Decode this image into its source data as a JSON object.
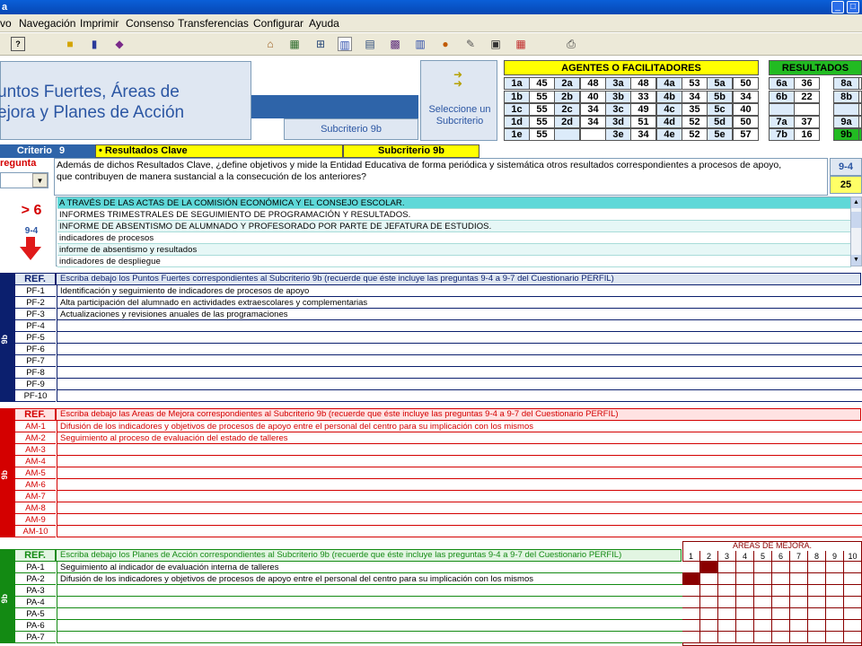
{
  "window": {
    "title_fragment": "a",
    "btn_min": "_",
    "btn_max": "□"
  },
  "menu": [
    "vo",
    "Navegación",
    "Imprimir",
    "Consenso",
    "Transferencias",
    "Configurar",
    "Ayuda"
  ],
  "header": {
    "title_line1": "untos Fuertes, Áreas de",
    "title_line2": "ejora y Planes de Acción",
    "subcriterio_label": "Subcriterio 9b",
    "select_label": "Seleccione un Subcriterio"
  },
  "agentes": {
    "title": "AGENTES O FACILITADORES",
    "rows": [
      [
        [
          "1a",
          "45"
        ],
        [
          "2a",
          "48"
        ],
        [
          "3a",
          "48"
        ],
        [
          "4a",
          "53"
        ],
        [
          "5a",
          "50"
        ]
      ],
      [
        [
          "1b",
          "55"
        ],
        [
          "2b",
          "40"
        ],
        [
          "3b",
          "33"
        ],
        [
          "4b",
          "34"
        ],
        [
          "5b",
          "34"
        ]
      ],
      [
        [
          "1c",
          "55"
        ],
        [
          "2c",
          "34"
        ],
        [
          "3c",
          "49"
        ],
        [
          "4c",
          "35"
        ],
        [
          "5c",
          "40"
        ]
      ],
      [
        [
          "1d",
          "55"
        ],
        [
          "2d",
          "34"
        ],
        [
          "3d",
          "51"
        ],
        [
          "4d",
          "52"
        ],
        [
          "5d",
          "50"
        ]
      ],
      [
        [
          "1e",
          "55"
        ],
        [
          "",
          ""
        ],
        [
          "3e",
          "34"
        ],
        [
          "4e",
          "52"
        ],
        [
          "5e",
          "57"
        ]
      ]
    ]
  },
  "resultados": {
    "title": "RESULTADOS",
    "rows": [
      [
        [
          "6a",
          "36"
        ],
        [
          "8a",
          ""
        ]
      ],
      [
        [
          "6b",
          "22"
        ],
        [
          "8b",
          ""
        ]
      ],
      [
        [
          "",
          ""
        ],
        [
          "",
          ""
        ]
      ],
      [
        [
          "7a",
          "37"
        ],
        [
          "9a",
          ""
        ]
      ],
      [
        [
          "7b",
          "16"
        ],
        [
          "9b",
          ""
        ]
      ]
    ]
  },
  "criterio": {
    "label": "Criterio",
    "num": "9",
    "clave": "• Resultados Clave",
    "sub": "Subcriterio 9b"
  },
  "pregunta": {
    "label": "regunta",
    "text1": "Además de dichos Resultados Clave, ¿define objetivos y mide la Entidad Educativa de forma periódica y sistemática otros resultados correspondientes a procesos de apoyo,",
    "text2": "que contribuyen de manera sustancial a la consecución de los anteriores?",
    "code": "9-4",
    "score": "25"
  },
  "indicator": {
    "gt": "> 6",
    "code": "9-4"
  },
  "answers": [
    "A TRAVÉS DE LAS ACTAS DE LA COMISIÓN ECONÓMICA Y EL CONSEJO ESCOLAR.",
    "INFORMES TRIMESTRALES DE SEGUIMIENTO DE PROGRAMACIÓN Y RESULTADOS.",
    "INFORME DE ABSENTISMO DE ALUMNADO Y PROFESORADO POR PARTE DE JEFATURA DE ESTUDIOS.",
    "indicadores de procesos",
    "informe de absentismo y resultados",
    "indicadores de despliegue"
  ],
  "pf": {
    "ref": "REF.",
    "header": "Escriba debajo los Puntos Fuertes correspondientes al Subcriterio 9b (recuerde que éste incluye las preguntas 9-4 a 9-7 del Cuestionario PERFIL)",
    "side": "9b",
    "rows": [
      [
        "PF-1",
        "Identificación y seguimiento de indicadores de procesos de apoyo"
      ],
      [
        "PF-2",
        "Alta participación del alumnado en actividades extraescolares y complementarias"
      ],
      [
        "PF-3",
        "Actualizaciones y revisiones anuales de las programaciones"
      ],
      [
        "PF-4",
        ""
      ],
      [
        "PF-5",
        ""
      ],
      [
        "PF-6",
        ""
      ],
      [
        "PF-7",
        ""
      ],
      [
        "PF-8",
        ""
      ],
      [
        "PF-9",
        ""
      ],
      [
        "PF-10",
        ""
      ]
    ]
  },
  "am": {
    "ref": "REF.",
    "header": "Escriba debajo las Areas de Mejora correspondientes al Subcriterio 9b (recuerde que éste incluye las preguntas 9-4 a 9-7 del Cuestionario PERFIL)",
    "side": "9b",
    "rows": [
      [
        "AM-1",
        "Difusión de los indicadores y objetivos de procesos de apoyo entre el personal del centro para su implicación con los mismos"
      ],
      [
        "AM-2",
        "Seguimiento al proceso de evaluación del estado de talleres"
      ],
      [
        "AM-3",
        ""
      ],
      [
        "AM-4",
        ""
      ],
      [
        "AM-5",
        ""
      ],
      [
        "AM-6",
        ""
      ],
      [
        "AM-7",
        ""
      ],
      [
        "AM-8",
        ""
      ],
      [
        "AM-9",
        ""
      ],
      [
        "AM-10",
        ""
      ]
    ]
  },
  "pa": {
    "ref": "REF.",
    "header": "Escriba debajo los Planes de Acción correspondientes al Subcriterio 9b (recuerde que éste incluye las preguntas 9-4 a 9-7 del Cuestionario PERFIL)",
    "side": "9b",
    "rows": [
      [
        "PA-1",
        "Seguimiento al indicador de evaluación interna de talleres"
      ],
      [
        "PA-2",
        "Difusión de los indicadores y objetivos de procesos de apoyo entre el personal del centro para su implicación con los mismos"
      ],
      [
        "PA-3",
        ""
      ],
      [
        "PA-4",
        ""
      ],
      [
        "PA-5",
        ""
      ],
      [
        "PA-6",
        ""
      ],
      [
        "PA-7",
        ""
      ]
    ]
  },
  "areas_mejora": {
    "title": "AREAS DE MEJORA.",
    "cols": [
      "1",
      "2",
      "3",
      "4",
      "5",
      "6",
      "7",
      "8",
      "9",
      "10"
    ],
    "filled": [
      [
        0,
        1
      ],
      [
        1,
        0
      ]
    ]
  },
  "colors": {
    "pf": "#0b1f6e",
    "am": "#d40000",
    "pa": "#138a13",
    "darkred": "#8a0000"
  }
}
